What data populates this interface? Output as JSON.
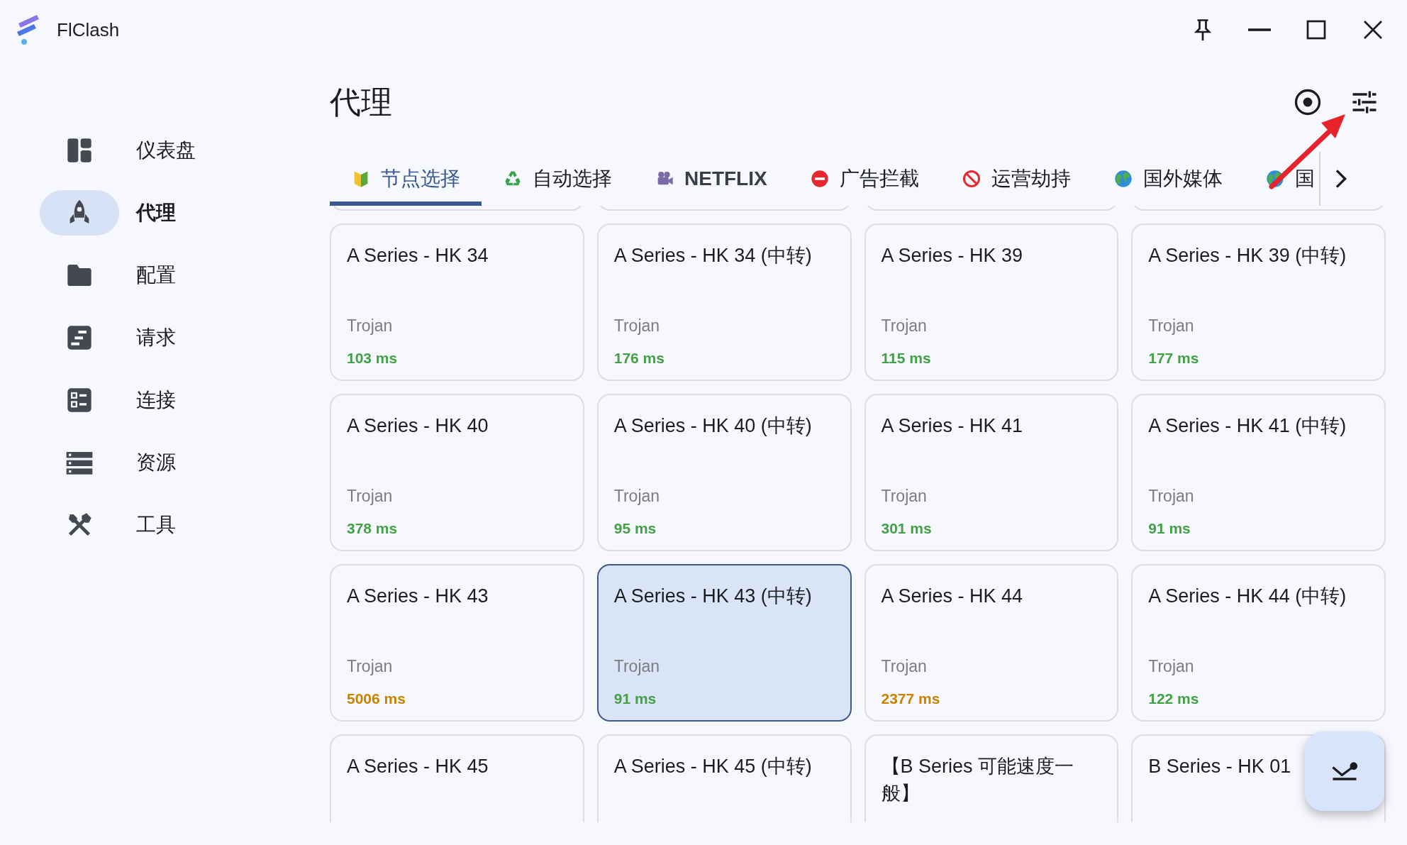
{
  "window": {
    "title": "FlClash"
  },
  "sidebar": {
    "items": [
      {
        "label": "仪表盘",
        "selected": false
      },
      {
        "label": "代理",
        "selected": true
      },
      {
        "label": "配置",
        "selected": false
      },
      {
        "label": "请求",
        "selected": false
      },
      {
        "label": "连接",
        "selected": false
      },
      {
        "label": "资源",
        "selected": false
      },
      {
        "label": "工具",
        "selected": false
      }
    ]
  },
  "page": {
    "title": "代理"
  },
  "tabs": [
    {
      "label": "节点选择",
      "selected": true
    },
    {
      "label": "自动选择",
      "selected": false
    },
    {
      "label": "NETFLIX",
      "selected": false
    },
    {
      "label": "广告拦截",
      "selected": false
    },
    {
      "label": "运营劫持",
      "selected": false
    },
    {
      "label": "国外媒体",
      "selected": false
    },
    {
      "label": "国",
      "selected": false
    }
  ],
  "proxies": [
    {
      "name": "A Series - HK 34",
      "type": "Trojan",
      "latency": "103 ms",
      "color": "#43a047",
      "selected": false
    },
    {
      "name": "A Series - HK 34 (中转)",
      "type": "Trojan",
      "latency": "176 ms",
      "color": "#43a047",
      "selected": false
    },
    {
      "name": "A Series - HK 39",
      "type": "Trojan",
      "latency": "115 ms",
      "color": "#43a047",
      "selected": false
    },
    {
      "name": "A Series - HK 39 (中转)",
      "type": "Trojan",
      "latency": "177 ms",
      "color": "#43a047",
      "selected": false
    },
    {
      "name": "A Series - HK 40",
      "type": "Trojan",
      "latency": "378 ms",
      "color": "#43a047",
      "selected": false
    },
    {
      "name": "A Series - HK 40 (中转)",
      "type": "Trojan",
      "latency": "95 ms",
      "color": "#43a047",
      "selected": false
    },
    {
      "name": "A Series - HK 41",
      "type": "Trojan",
      "latency": "301 ms",
      "color": "#43a047",
      "selected": false
    },
    {
      "name": "A Series - HK 41 (中转)",
      "type": "Trojan",
      "latency": "91 ms",
      "color": "#43a047",
      "selected": false
    },
    {
      "name": "A Series - HK 43",
      "type": "Trojan",
      "latency": "5006 ms",
      "color": "#c98300",
      "selected": false
    },
    {
      "name": "A Series - HK 43 (中转)",
      "type": "Trojan",
      "latency": "91 ms",
      "color": "#43a047",
      "selected": true
    },
    {
      "name": "A Series - HK 44",
      "type": "Trojan",
      "latency": "2377 ms",
      "color": "#c98300",
      "selected": false
    },
    {
      "name": "A Series - HK 44 (中转)",
      "type": "Trojan",
      "latency": "122 ms",
      "color": "#43a047",
      "selected": false
    },
    {
      "name": "A Series - HK 45",
      "selected": false
    },
    {
      "name": "A Series - HK 45 (中转)",
      "selected": false
    },
    {
      "name": "【B Series 可能速度一般】",
      "selected": false
    },
    {
      "name": "B Series - HK 01",
      "selected": false
    }
  ]
}
